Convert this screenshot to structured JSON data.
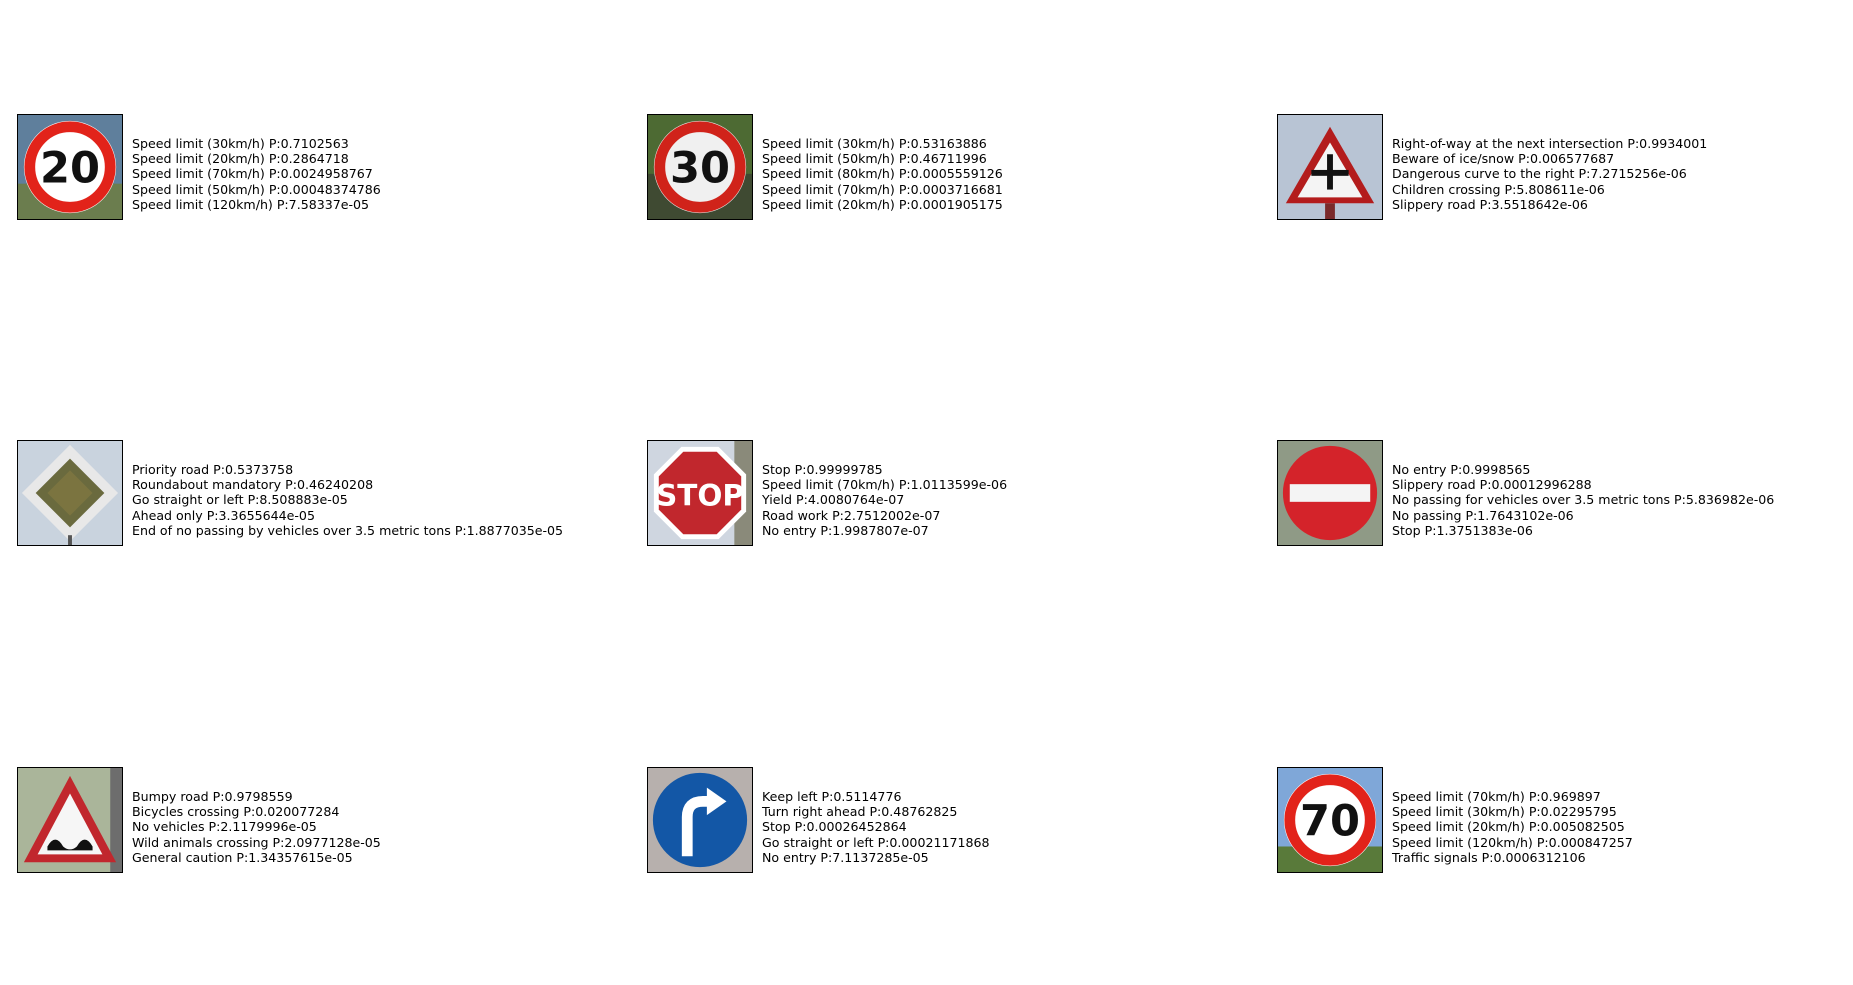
{
  "grid": [
    {
      "sign": "speed-limit-20",
      "image_number": "20",
      "predictions": [
        "Speed limit (30km/h) P:0.7102563",
        "Speed limit (20km/h) P:0.2864718",
        "Speed limit (70km/h) P:0.0024958767",
        "Speed limit (50km/h) P:0.00048374786",
        "Speed limit (120km/h) P:7.58337e-05"
      ]
    },
    {
      "sign": "speed-limit-30",
      "image_number": "30",
      "predictions": [
        "Speed limit (30km/h) P:0.53163886",
        "Speed limit (50km/h) P:0.46711996",
        "Speed limit (80km/h) P:0.0005559126",
        "Speed limit (70km/h) P:0.0003716681",
        "Speed limit (20km/h) P:0.0001905175"
      ]
    },
    {
      "sign": "right-of-way-intersection",
      "image_number": "",
      "predictions": [
        "Right-of-way at the next intersection P:0.9934001",
        "Beware of ice/snow P:0.006577687",
        "Dangerous curve to the right P:7.2715256e-06",
        "Children crossing P:5.808611e-06",
        "Slippery road P:3.5518642e-06"
      ]
    },
    {
      "sign": "priority-road",
      "image_number": "",
      "predictions": [
        "Priority road P:0.5373758",
        "Roundabout mandatory P:0.46240208",
        "Go straight or left P:8.508883e-05",
        "Ahead only P:3.3655644e-05",
        "End of no passing by vehicles over 3.5 metric tons P:1.8877035e-05"
      ]
    },
    {
      "sign": "stop",
      "image_number": "STOP",
      "predictions": [
        "Stop P:0.99999785",
        "Speed limit (70km/h) P:1.0113599e-06",
        "Yield P:4.0080764e-07",
        "Road work P:2.7512002e-07",
        "No entry P:1.9987807e-07"
      ]
    },
    {
      "sign": "no-entry",
      "image_number": "",
      "predictions": [
        "No entry P:0.9998565",
        "Slippery road P:0.00012996288",
        "No passing for vehicles over 3.5 metric tons P:5.836982e-06",
        "No passing P:1.7643102e-06",
        "Stop P:1.3751383e-06"
      ]
    },
    {
      "sign": "bumpy-road",
      "image_number": "",
      "predictions": [
        "Bumpy road P:0.9798559",
        "Bicycles crossing P:0.020077284",
        "No vehicles P:2.1179996e-05",
        "Wild animals crossing P:2.0977128e-05",
        "General caution P:1.34357615e-05"
      ]
    },
    {
      "sign": "turn-right-ahead",
      "image_number": "",
      "predictions": [
        "Keep left P:0.5114776",
        "Turn right ahead P:0.48762825",
        "Stop P:0.00026452864",
        "Go straight or left P:0.00021171868",
        "No entry P:7.1137285e-05"
      ]
    },
    {
      "sign": "speed-limit-70",
      "image_number": "70",
      "predictions": [
        "Speed limit (70km/h) P:0.969897",
        "Speed limit (30km/h) P:0.02295795",
        "Speed limit (20km/h) P:0.005082505",
        "Speed limit (120km/h) P:0.000847257",
        "Traffic signals P:0.0006312106"
      ]
    }
  ]
}
